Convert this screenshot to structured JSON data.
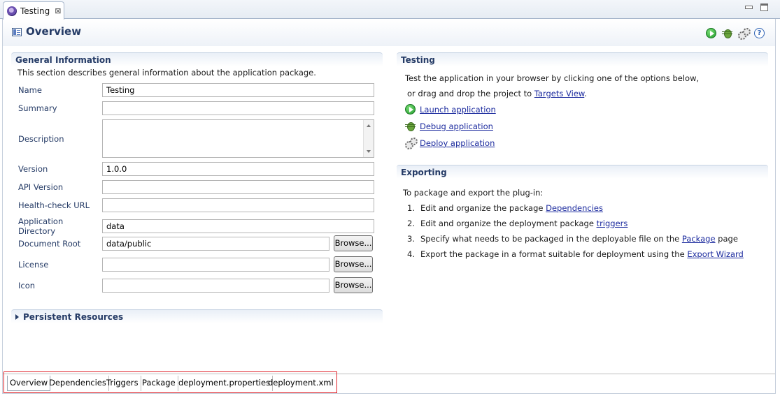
{
  "editor_tab": {
    "label": "Testing",
    "close": "⊠"
  },
  "header": {
    "title": "Overview"
  },
  "general": {
    "title": "General Information",
    "description": "This section describes general information about the application package.",
    "fields": {
      "name": {
        "label": "Name",
        "value": "Testing"
      },
      "summary": {
        "label": "Summary",
        "value": ""
      },
      "description": {
        "label": "Description",
        "value": ""
      },
      "version": {
        "label": "Version",
        "value": "1.0.0"
      },
      "api_version": {
        "label": "API Version",
        "value": ""
      },
      "health_check": {
        "label": "Health-check URL",
        "value": ""
      },
      "app_dir": {
        "label": "Application Directory",
        "value": "data"
      },
      "doc_root": {
        "label": "Document Root",
        "value": "data/public"
      },
      "license": {
        "label": "License",
        "value": ""
      },
      "icon": {
        "label": "Icon",
        "value": ""
      }
    },
    "browse_label": "Browse..."
  },
  "persistent": {
    "title": "Persistent Resources"
  },
  "testing": {
    "title": "Testing",
    "line1": "Test the application in your browser by clicking one of the options below,",
    "line2_prefix": "or drag and drop the project to ",
    "line2_link": "Targets View",
    "line2_suffix": ".",
    "actions": {
      "launch": "Launch application",
      "debug": "Debug application",
      "deploy": "Deploy application"
    }
  },
  "exporting": {
    "title": "Exporting",
    "intro": "To package and export the plug-in:",
    "steps": [
      {
        "num": "1.",
        "text": "Edit and organize the package ",
        "link": "Dependencies",
        "suffix": ""
      },
      {
        "num": "2.",
        "text": "Edit and organize the deployment package ",
        "link": "triggers",
        "suffix": ""
      },
      {
        "num": "3.",
        "text": "Specify what needs to be packaged in the deployable file on the ",
        "link": "Package",
        "suffix": " page"
      },
      {
        "num": "4.",
        "text": "Export the package in a format suitable for deployment using the ",
        "link": "Export Wizard",
        "suffix": ""
      }
    ]
  },
  "page_tabs": [
    "Overview",
    "Dependencies",
    "Triggers",
    "Package",
    "deployment.properties",
    "deployment.xml"
  ],
  "colors": {
    "accent": "#253b66",
    "link": "#1b2a9e",
    "highlight": "#e0242b"
  }
}
